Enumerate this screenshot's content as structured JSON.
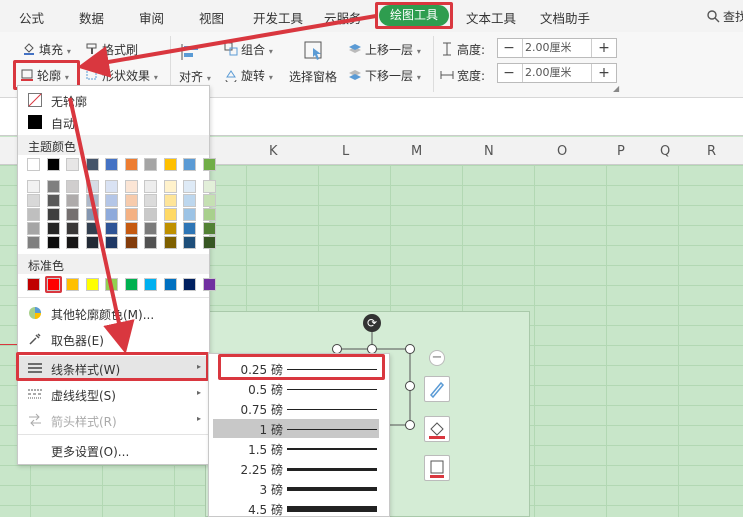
{
  "tabs": [
    "公式",
    "数据",
    "审阅",
    "视图",
    "开发工具",
    "云服务",
    "绘图工具",
    "文本工具",
    "文档助手"
  ],
  "search_label": "查找",
  "ribbon": {
    "fill": "填充",
    "format_brush": "格式刷",
    "outline": "轮廓",
    "shape_effect": "形状效果",
    "align": "对齐",
    "group": "组合",
    "rotate": "旋转",
    "selection_pane": "选择窗格",
    "bring_forward": "上移一层",
    "send_backward": "下移一层",
    "height_label": "高度:",
    "width_label": "宽度:",
    "height_value": "2.00厘米",
    "width_value": "2.00厘米",
    "minus": "−",
    "plus": "+"
  },
  "columns": [
    "K",
    "L",
    "M",
    "N",
    "O",
    "P",
    "Q",
    "R"
  ],
  "menu": {
    "no_outline": "无轮廓",
    "auto": "自动",
    "theme_colors": "主题颜色",
    "standard_colors": "标准色",
    "more_colors": "其他轮廓颜色(M)...",
    "eyedropper": "取色器(E)",
    "line_style": "线条样式(W)",
    "dash_type": "虚线线型(S)",
    "arrow_style": "箭头样式(R)",
    "more_settings": "更多设置(O)..."
  },
  "theme_colors_row": [
    "#ffffff",
    "#000000",
    "#e7e6e6",
    "#44546a",
    "#4472c4",
    "#ed7d31",
    "#a5a5a5",
    "#ffc000",
    "#5b9bd5",
    "#70ad47"
  ],
  "theme_shades": [
    [
      "#f2f2f2",
      "#7f7f7f",
      "#d0cece",
      "#d6dce4",
      "#d9e2f3",
      "#fbe5d5",
      "#ededed",
      "#fff2cc",
      "#deeaf6",
      "#e2efd9"
    ],
    [
      "#d8d8d8",
      "#595959",
      "#aeabab",
      "#adb9ca",
      "#b4c6e7",
      "#f7cbac",
      "#dbdbdb",
      "#fee599",
      "#bdd7ee",
      "#c5e0b3"
    ],
    [
      "#bfbfbf",
      "#3f3f3f",
      "#757070",
      "#8496b0",
      "#8eaadb",
      "#f4b183",
      "#c9c9c9",
      "#ffd965",
      "#9cc3e5",
      "#a8d08d"
    ],
    [
      "#a5a5a5",
      "#262626",
      "#3a3838",
      "#333f4f",
      "#2f5496",
      "#c55a11",
      "#7b7b7b",
      "#bf9000",
      "#2e75b5",
      "#538135"
    ],
    [
      "#7f7f7f",
      "#0c0c0c",
      "#171616",
      "#222a35",
      "#1f3864",
      "#833c0b",
      "#525252",
      "#7f6000",
      "#1e4e79",
      "#375623"
    ]
  ],
  "standard_colors_row": [
    "#c00000",
    "#ff0000",
    "#ffc000",
    "#ffff00",
    "#92d050",
    "#00b050",
    "#00b0f0",
    "#0070c0",
    "#002060",
    "#7030a0"
  ],
  "line_weights": [
    {
      "label": "0.25 磅",
      "weight": 0.25
    },
    {
      "label": "0.5 磅",
      "weight": 0.5
    },
    {
      "label": "0.75 磅",
      "weight": 0.75
    },
    {
      "label": "1 磅",
      "weight": 1
    },
    {
      "label": "1.5 磅",
      "weight": 1.5
    },
    {
      "label": "2.25 磅",
      "weight": 2.25
    },
    {
      "label": "3 磅",
      "weight": 3
    },
    {
      "label": "4.5 磅",
      "weight": 4.5
    }
  ],
  "colors": {
    "accent_green": "#2e9d4f",
    "highlight_red": "#d9373f"
  }
}
